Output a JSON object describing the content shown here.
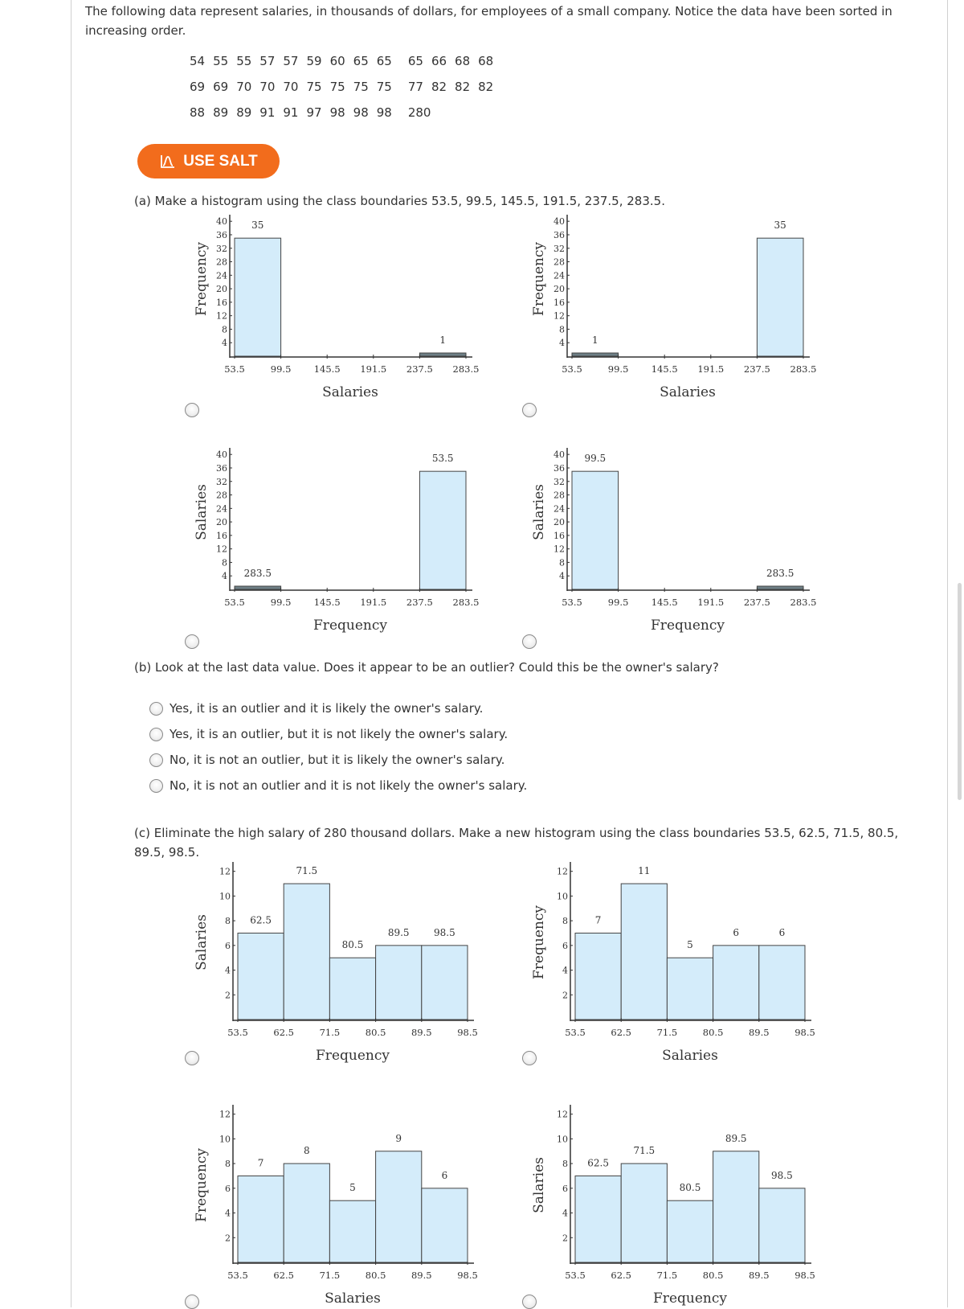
{
  "intro": "The following data represent salaries, in thousands of dollars, for employees of a small company. Notice the data have been sorted in increasing order.",
  "data_rows": [
    [
      "54",
      "55",
      "55",
      "57",
      "57",
      "59",
      "60",
      "65",
      "65",
      "65",
      "66",
      "68",
      "68"
    ],
    [
      "69",
      "69",
      "70",
      "70",
      "70",
      "75",
      "75",
      "75",
      "75",
      "77",
      "82",
      "82",
      "82"
    ],
    [
      "88",
      "89",
      "89",
      "91",
      "91",
      "97",
      "98",
      "98",
      "98",
      "280"
    ]
  ],
  "salt_button": {
    "label": "USE SALT",
    "icon": "salt-chart-icon",
    "color": "#f26c1c"
  },
  "part_a": {
    "prompt": "(a) Make a histogram using the class boundaries 53.5, 99.5, 145.5, 191.5, 237.5, 283.5."
  },
  "part_b": {
    "prompt": "(b) Look at the last data value. Does it appear to be an outlier? Could this be the owner's salary?",
    "options": [
      "Yes, it is an outlier and it is likely the owner's salary.",
      "Yes, it is an outlier, but it is not likely the owner's salary.",
      "No, it is not an outlier, but it is likely the owner's salary.",
      "No, it is not an outlier and it is not likely the owner's salary."
    ]
  },
  "part_c": {
    "prompt": "(c) Eliminate the high salary of 280 thousand dollars. Make a new histogram using the class boundaries 53.5, 62.5, 71.5, 80.5, 89.5, 98.5."
  },
  "colors": {
    "bar_fill": "#d4ecfa",
    "bar_stroke": "#444444",
    "flat_bar_fill": "#6e7f86"
  },
  "chart_data": [
    {
      "id": "a1",
      "type": "bar",
      "part": "a",
      "xlabel": "Salaries",
      "ylabel": "Frequency",
      "boundaries": [
        "53.5",
        "99.5",
        "145.5",
        "191.5",
        "237.5",
        "283.5"
      ],
      "values": [
        35,
        0,
        0,
        0,
        1
      ],
      "bar_labels": [
        "35",
        "",
        "",
        "",
        "1"
      ],
      "yticks": [
        "4",
        "8",
        "12",
        "16",
        "20",
        "24",
        "28",
        "32",
        "36",
        "40"
      ],
      "ylim": [
        0,
        41
      ]
    },
    {
      "id": "a2",
      "type": "bar",
      "part": "a",
      "xlabel": "Salaries",
      "ylabel": "Frequency",
      "boundaries": [
        "53.5",
        "99.5",
        "145.5",
        "191.5",
        "237.5",
        "283.5"
      ],
      "values": [
        1,
        0,
        0,
        0,
        35
      ],
      "bar_labels": [
        "1",
        "",
        "",
        "",
        "35"
      ],
      "yticks": [
        "4",
        "8",
        "12",
        "16",
        "20",
        "24",
        "28",
        "32",
        "36",
        "40"
      ],
      "ylim": [
        0,
        41
      ]
    },
    {
      "id": "a3",
      "type": "bar",
      "part": "a",
      "xlabel": "Frequency",
      "ylabel": "Salaries",
      "boundaries": [
        "53.5",
        "99.5",
        "145.5",
        "191.5",
        "237.5",
        "283.5"
      ],
      "values": [
        1,
        0,
        0,
        0,
        35
      ],
      "bar_labels": [
        "283.5",
        "",
        "",
        "",
        "53.5"
      ],
      "yticks": [
        "4",
        "8",
        "12",
        "16",
        "20",
        "24",
        "28",
        "32",
        "36",
        "40"
      ],
      "ylim": [
        0,
        41
      ]
    },
    {
      "id": "a4",
      "type": "bar",
      "part": "a",
      "xlabel": "Frequency",
      "ylabel": "Salaries",
      "boundaries": [
        "53.5",
        "99.5",
        "145.5",
        "191.5",
        "237.5",
        "283.5"
      ],
      "values": [
        35,
        0,
        0,
        0,
        1
      ],
      "bar_labels": [
        "99.5",
        "",
        "",
        "",
        "283.5"
      ],
      "yticks": [
        "4",
        "8",
        "12",
        "16",
        "20",
        "24",
        "28",
        "32",
        "36",
        "40"
      ],
      "ylim": [
        0,
        41
      ]
    },
    {
      "id": "c1",
      "type": "bar",
      "part": "c",
      "xlabel": "Frequency",
      "ylabel": "Salaries",
      "boundaries": [
        "53.5",
        "62.5",
        "71.5",
        "80.5",
        "89.5",
        "98.5"
      ],
      "values": [
        7,
        11,
        5,
        6,
        6
      ],
      "bar_labels": [
        "62.5",
        "71.5",
        "80.5",
        "89.5",
        "98.5"
      ],
      "yticks": [
        "2",
        "4",
        "6",
        "8",
        "10",
        "12"
      ],
      "ylim": [
        0,
        12.5
      ]
    },
    {
      "id": "c2",
      "type": "bar",
      "part": "c",
      "xlabel": "Salaries",
      "ylabel": "Frequency",
      "boundaries": [
        "53.5",
        "62.5",
        "71.5",
        "80.5",
        "89.5",
        "98.5"
      ],
      "values": [
        7,
        11,
        5,
        6,
        6
      ],
      "bar_labels": [
        "7",
        "11",
        "5",
        "6",
        "6"
      ],
      "yticks": [
        "2",
        "4",
        "6",
        "8",
        "10",
        "12"
      ],
      "ylim": [
        0,
        12.5
      ]
    },
    {
      "id": "c3",
      "type": "bar",
      "part": "c",
      "xlabel": "Salaries",
      "ylabel": "Frequency",
      "boundaries": [
        "53.5",
        "62.5",
        "71.5",
        "80.5",
        "89.5",
        "98.5"
      ],
      "values": [
        7,
        8,
        5,
        9,
        6
      ],
      "bar_labels": [
        "7",
        "8",
        "5",
        "9",
        "6"
      ],
      "yticks": [
        "2",
        "4",
        "6",
        "8",
        "10",
        "12"
      ],
      "ylim": [
        0,
        12.5
      ]
    },
    {
      "id": "c4",
      "type": "bar",
      "part": "c",
      "xlabel": "Frequency",
      "ylabel": "Salaries",
      "boundaries": [
        "53.5",
        "62.5",
        "71.5",
        "80.5",
        "89.5",
        "98.5"
      ],
      "values": [
        7,
        8,
        5,
        9,
        6
      ],
      "bar_labels": [
        "62.5",
        "71.5",
        "80.5",
        "89.5",
        "98.5"
      ],
      "yticks": [
        "2",
        "4",
        "6",
        "8",
        "10",
        "12"
      ],
      "ylim": [
        0,
        12.5
      ]
    }
  ]
}
